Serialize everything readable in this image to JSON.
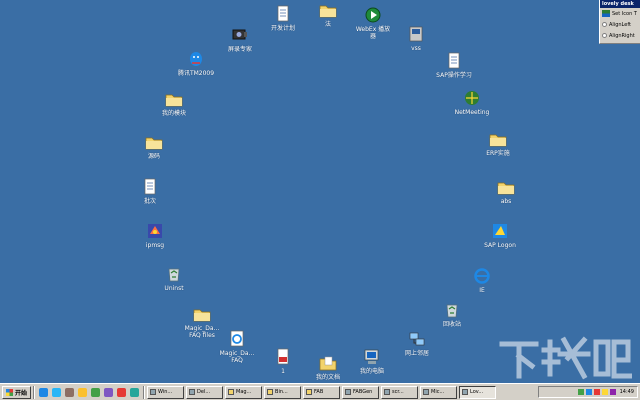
{
  "desktop": {
    "icons": [
      {
        "label": "开发计划",
        "icon": "document-icon"
      },
      {
        "label": "法",
        "icon": "folder-icon"
      },
      {
        "label": "WebEx 播放\n器",
        "icon": "player-icon"
      },
      {
        "label": "屏录专家",
        "icon": "recorder-icon"
      },
      {
        "label": "vss",
        "icon": "app-icon"
      },
      {
        "label": "腾讯TM2009",
        "icon": "qq-icon"
      },
      {
        "label": "SAP操作学习",
        "icon": "document-icon"
      },
      {
        "label": "我的模块",
        "icon": "folder-icon"
      },
      {
        "label": "NetMeeting",
        "icon": "netmeeting-icon"
      },
      {
        "label": "源码",
        "icon": "folder-icon"
      },
      {
        "label": "ERP实施",
        "icon": "folder-icon"
      },
      {
        "label": "批次",
        "icon": "document-icon"
      },
      {
        "label": "abs",
        "icon": "folder-icon"
      },
      {
        "label": "ipmsg",
        "icon": "ipmsg-icon"
      },
      {
        "label": "SAP Logon",
        "icon": "sap-icon"
      },
      {
        "label": "Uninst",
        "icon": "recycle-icon"
      },
      {
        "label": "IE",
        "icon": "ie-icon"
      },
      {
        "label": "Magic_Da...\nFAQ files",
        "icon": "folder-icon"
      },
      {
        "label": "回收站",
        "icon": "recycle-icon"
      },
      {
        "label": "Magic_Da...\nFAQ",
        "icon": "ie-doc-icon"
      },
      {
        "label": "网上邻居",
        "icon": "network-icon"
      },
      {
        "label": "1",
        "icon": "pdf-icon"
      },
      {
        "label": "我的文档",
        "icon": "mydocs-icon"
      },
      {
        "label": "我的电脑",
        "icon": "computer-icon"
      }
    ]
  },
  "panel": {
    "title": "lovely desk",
    "set_icon": "Set Icon T",
    "align_left": "AlignLeft",
    "align_right": "AlignRight"
  },
  "taskbar": {
    "start": "开始",
    "quick_launch": [
      "ie-icon",
      "qq-icon",
      "desktop-icon",
      "outlook-icon",
      "media-icon",
      "app-icon",
      "app-icon",
      "app-icon"
    ],
    "tasks": [
      {
        "label": "Win...",
        "icon": "app-icon"
      },
      {
        "label": "Del...",
        "icon": "app-icon"
      },
      {
        "label": "Mag...",
        "icon": "folder-icon"
      },
      {
        "label": "Bin...",
        "icon": "folder-icon"
      },
      {
        "label": "FAB",
        "icon": "folder-icon"
      },
      {
        "label": "FABGen",
        "icon": "app-icon"
      },
      {
        "label": "scr...",
        "icon": "app-icon"
      },
      {
        "label": "Mic...",
        "icon": "app-icon"
      },
      {
        "label": "Lov...",
        "icon": "app-icon",
        "active": true
      }
    ],
    "clock": "14:49"
  },
  "watermark": "下载吧",
  "colors": {
    "desktop": "#3A6EA5",
    "folder": "#F2D36B",
    "taskbar": "#D4D0C8"
  }
}
